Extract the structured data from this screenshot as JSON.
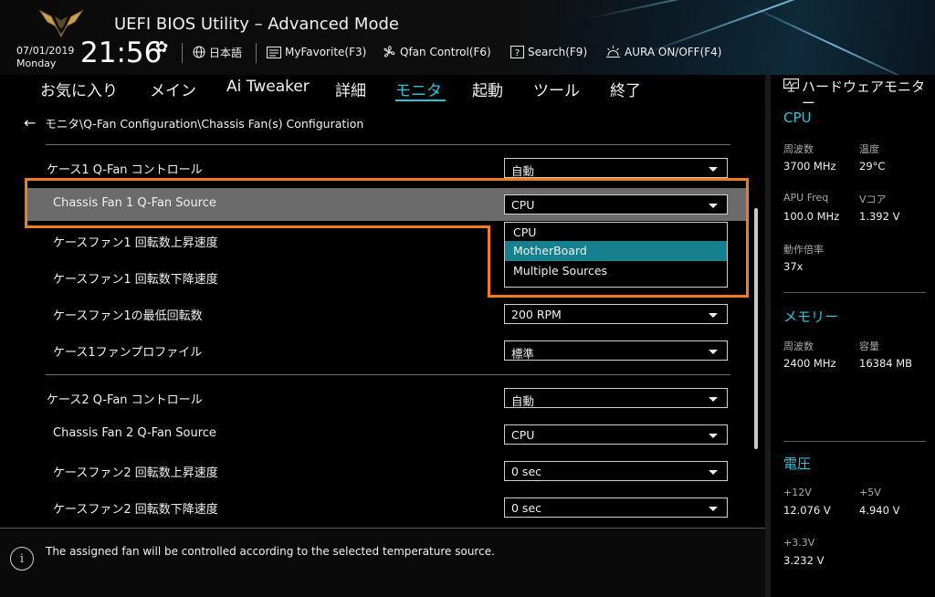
{
  "header": {
    "title": "UEFI BIOS Utility – Advanced Mode",
    "date": "07/01/2019",
    "day": "Monday",
    "time": "21:56",
    "language": "日本語",
    "myfavorite": "MyFavorite(F3)",
    "qfan": "Qfan Control(F6)",
    "search": "Search(F9)",
    "aura": "AURA ON/OFF(F4)"
  },
  "nav": {
    "tabs": [
      "お気に入り",
      "メイン",
      "Ai Tweaker",
      "詳細",
      "モニタ",
      "起動",
      "ツール",
      "終了"
    ],
    "active": "モニタ"
  },
  "breadcrumb": "モニタ\\Q-Fan Configuration\\Chassis Fan(s) Configuration",
  "rows": [
    {
      "label": "ケース1 Q-Fan コントロール",
      "value": "自動"
    },
    {
      "label": "Chassis Fan 1 Q-Fan Source",
      "value": "CPU"
    },
    {
      "label": "ケースファン1 回転数上昇速度",
      "value": ""
    },
    {
      "label": "ケースファン1 回転数下降速度",
      "value": ""
    },
    {
      "label": "ケースファン1の最低回転数",
      "value": "200 RPM"
    },
    {
      "label": "ケース1ファンプロファイル",
      "value": "標準"
    },
    {
      "label": "ケース2 Q-Fan コントロール",
      "value": "自動"
    },
    {
      "label": "Chassis Fan 2 Q-Fan Source",
      "value": "CPU"
    },
    {
      "label": "ケースファン2 回転数上昇速度",
      "value": "0 sec"
    },
    {
      "label": "ケースファン2 回転数下降速度",
      "value": "0 sec"
    }
  ],
  "dropdown_options": [
    "CPU",
    "MotherBoard",
    "Multiple Sources"
  ],
  "dropdown_highlighted": "MotherBoard",
  "help_text": "The assigned fan will be controlled according to the selected temperature source.",
  "hw_monitor": {
    "title": "ハードウェアモニター",
    "cpu": {
      "heading": "CPU",
      "freq_label": "周波数",
      "freq": "3700 MHz",
      "temp_label": "温度",
      "temp": "29°C",
      "apu_label": "APU Freq",
      "apu": "100.0 MHz",
      "vcore_label": "Vコア",
      "vcore": "1.392 V",
      "ratio_label": "動作倍率",
      "ratio": "37x"
    },
    "memory": {
      "heading": "メモリー",
      "freq_label": "周波数",
      "freq": "2400 MHz",
      "cap_label": "容量",
      "cap": "16384 MB"
    },
    "voltage": {
      "heading": "電圧",
      "v12_label": "+12V",
      "v12": "12.076 V",
      "v5_label": "+5V",
      "v5": "4.940 V",
      "v33_label": "+3.3V",
      "v33": "3.232 V"
    }
  },
  "colors": {
    "accent": "#26c6da",
    "highlight": "#17808e",
    "selected_row": "#6b6b6b",
    "annotation": "#f07c1e"
  }
}
